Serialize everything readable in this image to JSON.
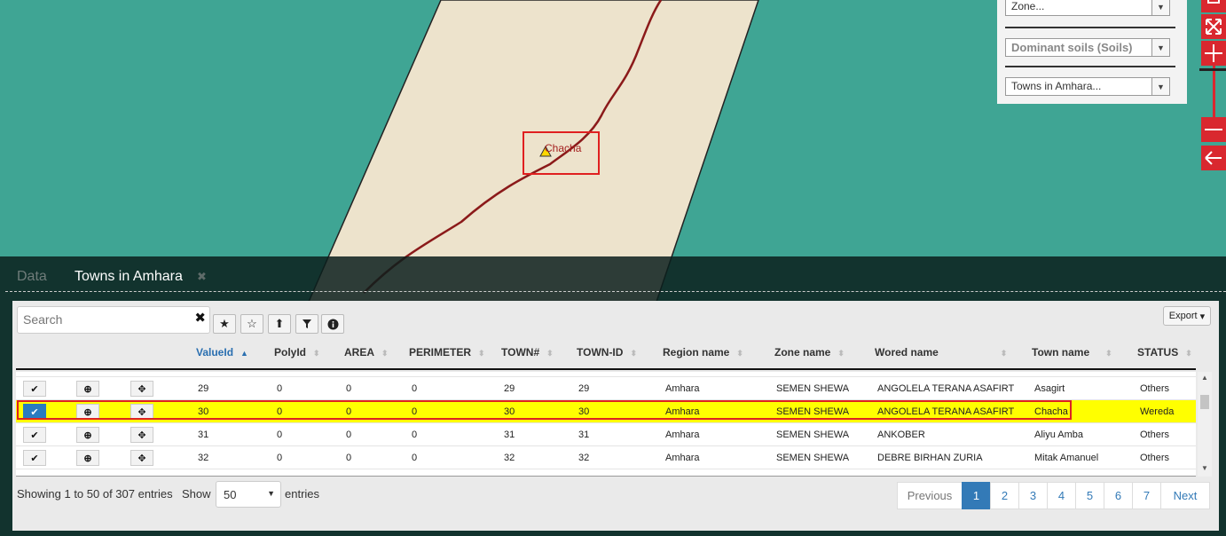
{
  "map": {
    "town_label": "Chacha",
    "colors": {
      "water": "#3fa594",
      "land": "#ede3cc",
      "river": "#8b1a1a"
    }
  },
  "layers": {
    "zone": "Zone...",
    "soils": "Dominant soils (Soils)",
    "towns": "Towns in Amhara..."
  },
  "tabs": {
    "data": "Data",
    "towns": "Towns in Amhara"
  },
  "toolbar": {
    "search_placeholder": "Search",
    "export": "Export"
  },
  "table": {
    "columns": [
      "ValueId",
      "PolyId",
      "AREA",
      "PERIMETER",
      "TOWN#",
      "TOWN-ID",
      "Region name",
      "Zone name",
      "Wored name",
      "Town name",
      "STATUS"
    ],
    "rows": [
      [
        "29",
        "0",
        "0",
        "0",
        "29",
        "29",
        "Amhara",
        "SEMEN SHEWA",
        "ANGOLELA TERANA ASAFIRT",
        "Asagirt",
        "Others"
      ],
      [
        "30",
        "0",
        "0",
        "0",
        "30",
        "30",
        "Amhara",
        "SEMEN SHEWA",
        "ANGOLELA TERANA ASAFIRT",
        "Chacha",
        "Wereda"
      ],
      [
        "31",
        "0",
        "0",
        "0",
        "31",
        "31",
        "Amhara",
        "SEMEN SHEWA",
        "ANKOBER",
        "Aliyu Amba",
        "Others"
      ],
      [
        "32",
        "0",
        "0",
        "0",
        "32",
        "32",
        "Amhara",
        "SEMEN SHEWA",
        "DEBRE BIRHAN ZURIA",
        "Mitak Amanuel",
        "Others"
      ]
    ],
    "selected_row": 1
  },
  "footer": {
    "info": "Showing 1 to 50 of 307 entries",
    "show": "Show",
    "page_size": "50",
    "entries": "entries",
    "pages": [
      "Previous",
      "1",
      "2",
      "3",
      "4",
      "5",
      "6",
      "7",
      "Next"
    ],
    "active_page": "1"
  }
}
